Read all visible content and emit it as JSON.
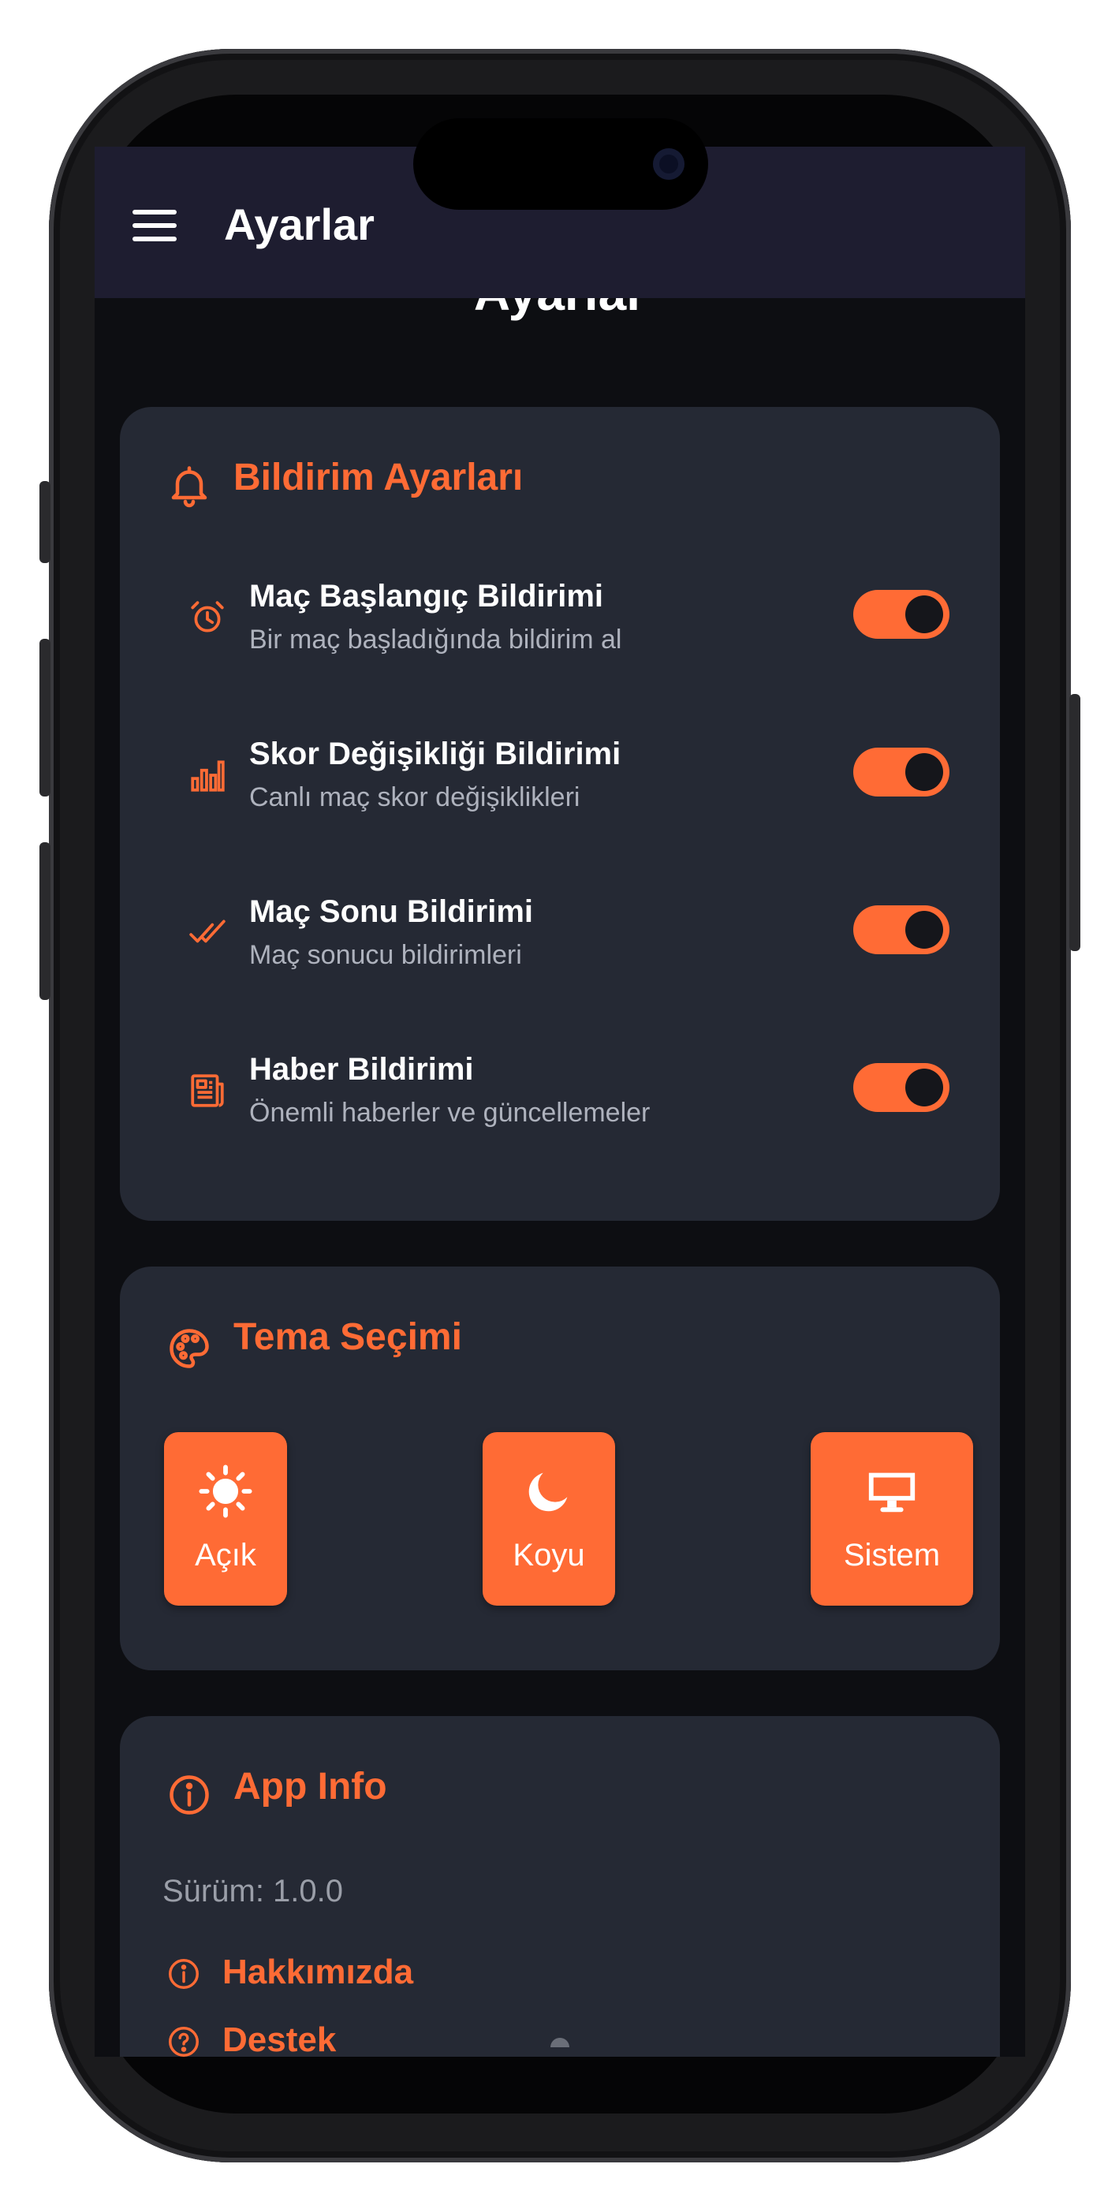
{
  "app_bar": {
    "title": "Ayarlar",
    "menu_icon": "menu-icon"
  },
  "page_heading": "Ayarlar",
  "accent_color": "#ff6b35",
  "notifications": {
    "title": "Bildirim Ayarları",
    "icon": "bell-icon",
    "items": [
      {
        "title": "Maç Başlangıç Bildirimi",
        "subtitle": "Bir maç başladığında bildirim al",
        "icon": "alarm-clock-icon",
        "enabled": true
      },
      {
        "title": "Skor Değişikliği Bildirimi",
        "subtitle": "Canlı maç skor değişiklikleri",
        "icon": "bar-chart-icon",
        "enabled": true
      },
      {
        "title": "Maç Sonu Bildirimi",
        "subtitle": "Maç sonucu bildirimleri",
        "icon": "double-check-icon",
        "enabled": true
      },
      {
        "title": "Haber Bildirimi",
        "subtitle": "Önemli haberler ve güncellemeler",
        "icon": "newspaper-icon",
        "enabled": true
      }
    ]
  },
  "theme": {
    "title": "Tema Seçimi",
    "icon": "palette-icon",
    "options": [
      {
        "label": "Açık",
        "icon": "sun-icon"
      },
      {
        "label": "Koyu",
        "icon": "moon-icon"
      },
      {
        "label": "Sistem",
        "icon": "monitor-icon"
      }
    ]
  },
  "app_info": {
    "title": "App Info",
    "icon": "info-icon",
    "version": "Sürüm: 1.0.0",
    "links": [
      {
        "label": "Hakkımızda",
        "icon": "info-icon"
      },
      {
        "label": "Destek",
        "icon": "help-icon"
      }
    ]
  }
}
